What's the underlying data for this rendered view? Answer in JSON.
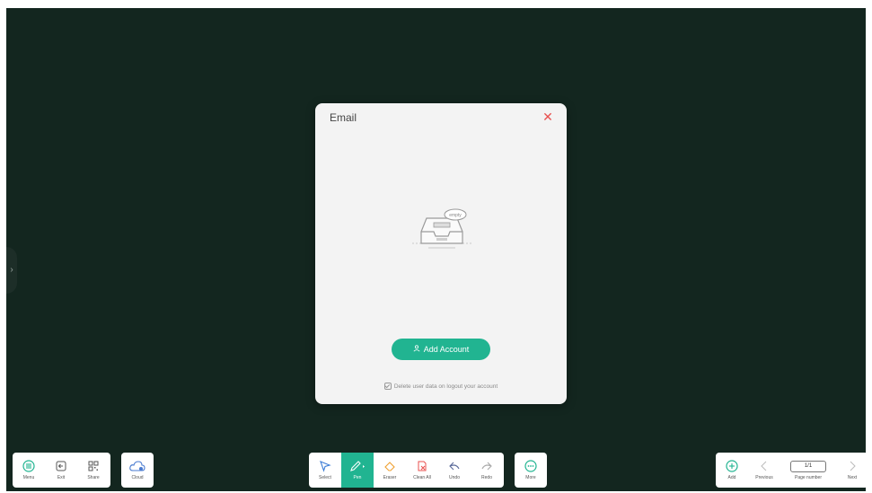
{
  "colors": {
    "board_bg": "#13261f",
    "accent": "#21b491",
    "close": "#e8504f"
  },
  "modal": {
    "title": "Email",
    "close_icon": "close-icon",
    "empty_badge": "empty",
    "add_account_label": "Add Account",
    "delete_note": "Delete user data on logout your account"
  },
  "left_toolbar": {
    "items": [
      {
        "label": "Menu",
        "icon": "menu-icon"
      },
      {
        "label": "Exit",
        "icon": "exit-icon"
      },
      {
        "label": "Share",
        "icon": "qr-code-icon"
      }
    ],
    "cloud": {
      "label": "Cloud",
      "icon": "cloud-icon"
    }
  },
  "center_toolbar": {
    "items": [
      {
        "label": "Select",
        "icon": "cursor-icon"
      },
      {
        "label": "Pen",
        "icon": "pen-icon",
        "active": true
      },
      {
        "label": "Eraser",
        "icon": "eraser-icon"
      },
      {
        "label": "Clean All",
        "icon": "clean-all-icon"
      },
      {
        "label": "Undo",
        "icon": "undo-icon"
      },
      {
        "label": "Redo",
        "icon": "redo-icon"
      }
    ],
    "more": {
      "label": "More",
      "icon": "more-icon"
    }
  },
  "right_toolbar": {
    "add_label": "Add",
    "previous_label": "Previous",
    "page_number_value": "1/1",
    "page_number_label": "Page number",
    "next_label": "Next"
  }
}
